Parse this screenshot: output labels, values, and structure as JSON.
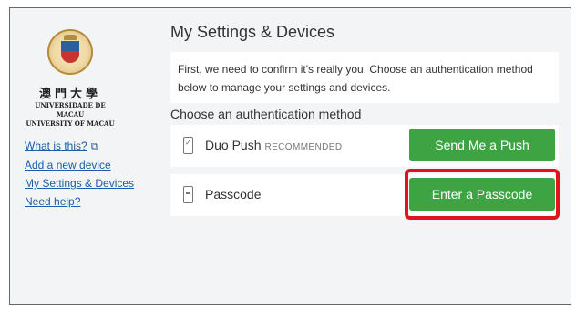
{
  "brand": {
    "chinese_name": "澳門大學",
    "portuguese_name": "UNIVERSIDADE DE MACAU",
    "english_name": "UNIVERSITY OF MACAU",
    "seal_icon": "university-seal-icon"
  },
  "sidebar_links": [
    {
      "label": "What is this?",
      "icon": "external-link-icon"
    },
    {
      "label": "Add a new device"
    },
    {
      "label": "My Settings & Devices"
    },
    {
      "label": "Need help?"
    }
  ],
  "main": {
    "title": "My Settings & Devices",
    "notice": "First, we need to confirm it's really you. Choose an authentication method below to manage your settings and devices.",
    "subheading": "Choose an authentication method",
    "methods": [
      {
        "label": "Duo Push",
        "badge": "RECOMMENDED",
        "button": "Send Me a Push",
        "icon": "phone-icon"
      },
      {
        "label": "Passcode",
        "badge": "",
        "button": "Enter a Passcode",
        "icon": "token-icon"
      }
    ]
  },
  "colors": {
    "button_green": "#3ea343",
    "highlight_red": "#e0151b",
    "link_blue": "#1b5cab"
  }
}
